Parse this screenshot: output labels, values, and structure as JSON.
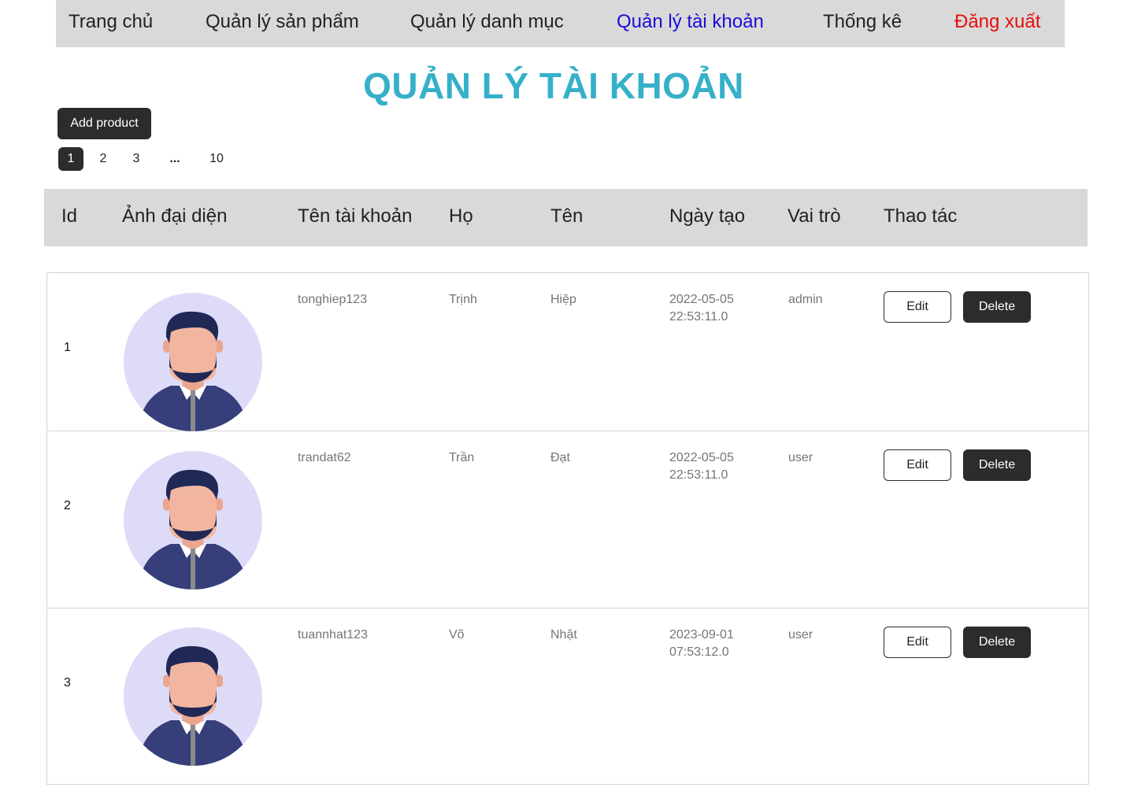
{
  "nav": {
    "items": [
      {
        "label": "Trang chủ"
      },
      {
        "label": "Quản lý sản phẩm"
      },
      {
        "label": "Quản lý danh mục"
      },
      {
        "label": "Quản lý tài khoản",
        "active": true
      },
      {
        "label": "Thống kê"
      },
      {
        "label": "Đăng xuất"
      }
    ],
    "active_color": "#1a0dd8",
    "logout_color": "#e30e0e"
  },
  "page": {
    "title": "QUẢN LÝ TÀI KHOẢN",
    "title_color": "#36b0c9",
    "add_button": "Add product"
  },
  "pagination": {
    "pages": [
      "1",
      "2",
      "3",
      "...",
      "10"
    ],
    "current": "1"
  },
  "table": {
    "columns": [
      "Id",
      "Ảnh đại diện",
      "Tên tài khoản",
      "Họ",
      "Tên",
      "Ngày tạo",
      "Vai trò",
      "Thao tác"
    ],
    "rows": [
      {
        "id": "1",
        "avatar": "male-avatar-icon",
        "username": "tonghiep123",
        "last_name": "Trịnh",
        "first_name": "Hiệp",
        "created": "2022-05-05 22:53:11.0",
        "role": "admin",
        "edit": "Edit",
        "delete": "Delete"
      },
      {
        "id": "2",
        "avatar": "male-avatar-icon",
        "username": "trandat62",
        "last_name": "Trần",
        "first_name": "Đạt",
        "created": "2022-05-05 22:53:11.0",
        "role": "user",
        "edit": "Edit",
        "delete": "Delete"
      },
      {
        "id": "3",
        "avatar": "male-avatar-icon",
        "username": "tuannhat123",
        "last_name": "Võ",
        "first_name": "Nhật",
        "created": "2023-09-01 07:53:12.0",
        "role": "user",
        "edit": "Edit",
        "delete": "Delete"
      }
    ]
  }
}
